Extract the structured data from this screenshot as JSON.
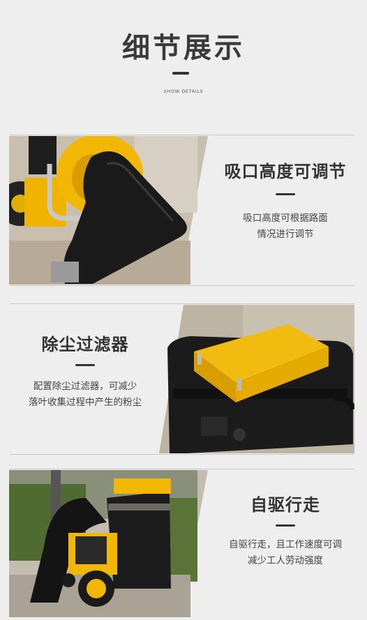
{
  "header": {
    "title": "细节展示",
    "subtitle": "SHOW DETAILS"
  },
  "features": [
    {
      "title": "吸口高度可调节",
      "desc_lines": [
        "吸口高度可根据路面",
        "情况进行调节"
      ],
      "image": "suction-nozzle-photo"
    },
    {
      "title": "除尘过滤器",
      "desc_lines": [
        "配置除尘过滤器，可减少",
        "落叶收集过程中产生的粉尘"
      ],
      "image": "dust-filter-photo"
    },
    {
      "title": "自驱行走",
      "desc_lines": [
        "自驱行走，且工作速度可调",
        "减少工人劳动强度"
      ],
      "image": "self-propelled-machine-photo"
    }
  ],
  "colors": {
    "background": "#eeeeee",
    "accent_yellow": "#f2b705",
    "machine_black": "#1c1c1c",
    "text_dark": "#333333"
  }
}
